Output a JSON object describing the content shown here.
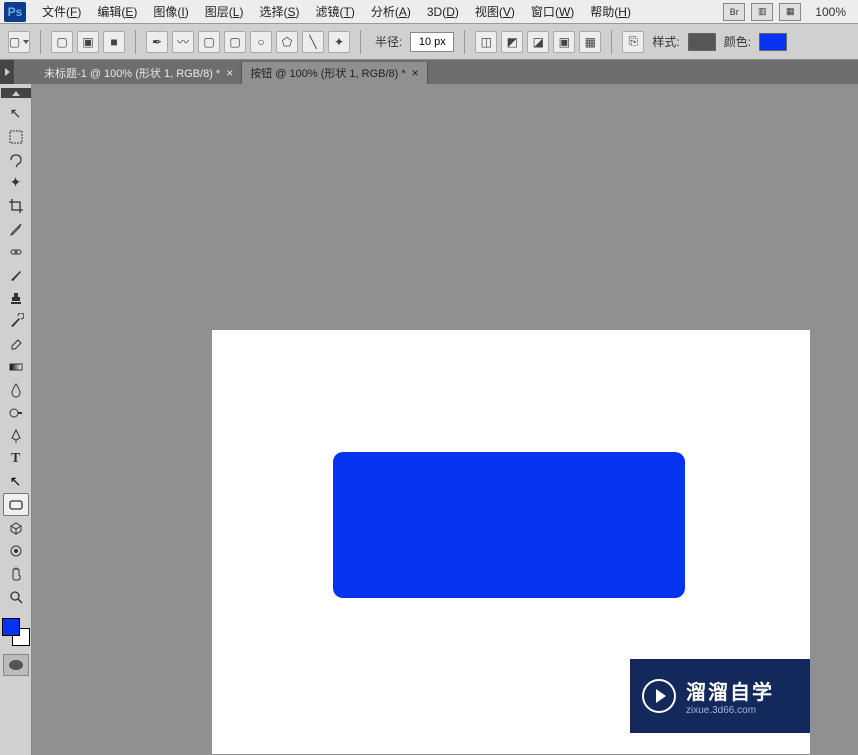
{
  "app": {
    "logo": "Ps",
    "zoom": "100%"
  },
  "menu": [
    {
      "label": "文件",
      "key": "F"
    },
    {
      "label": "编辑",
      "key": "E"
    },
    {
      "label": "图像",
      "key": "I"
    },
    {
      "label": "图层",
      "key": "L"
    },
    {
      "label": "选择",
      "key": "S"
    },
    {
      "label": "滤镜",
      "key": "T"
    },
    {
      "label": "分析",
      "key": "A"
    },
    {
      "label": "3D",
      "key": "D"
    },
    {
      "label": "视图",
      "key": "V"
    },
    {
      "label": "窗口",
      "key": "W"
    },
    {
      "label": "帮助",
      "key": "H"
    }
  ],
  "options": {
    "radius_label": "半径:",
    "radius_value": "10 px",
    "style_label": "样式:",
    "color_label": "颜色:",
    "style_color": "#565656",
    "fill_color": "#0533ef"
  },
  "tabs": [
    {
      "title": "未标题-1 @ 100% (形状 1, RGB/8) *",
      "active": false
    },
    {
      "title": "按钮 @ 100% (形状 1, RGB/8) *",
      "active": true
    }
  ],
  "tools": [
    {
      "name": "move-tool",
      "glyph": "↖"
    },
    {
      "name": "marquee-tool",
      "glyph": "⬚"
    },
    {
      "name": "lasso-tool",
      "glyph": "⊃"
    },
    {
      "name": "magic-wand-tool",
      "glyph": "✦"
    },
    {
      "name": "crop-tool",
      "glyph": "✂"
    },
    {
      "name": "eyedropper-tool",
      "glyph": "✎"
    },
    {
      "name": "healing-tool",
      "glyph": "✚"
    },
    {
      "name": "brush-tool",
      "glyph": "/"
    },
    {
      "name": "stamp-tool",
      "glyph": "♜"
    },
    {
      "name": "history-brush-tool",
      "glyph": "↺"
    },
    {
      "name": "eraser-tool",
      "glyph": "◪"
    },
    {
      "name": "gradient-tool",
      "glyph": "▦"
    },
    {
      "name": "blur-tool",
      "glyph": "💧"
    },
    {
      "name": "dodge-tool",
      "glyph": "🔍"
    },
    {
      "name": "pen-tool",
      "glyph": "✒"
    },
    {
      "name": "type-tool",
      "glyph": "T"
    },
    {
      "name": "path-selection-tool",
      "glyph": "↗"
    },
    {
      "name": "rectangle-tool",
      "glyph": "▢",
      "active": true
    },
    {
      "name": "3d-tool",
      "glyph": "⬣"
    },
    {
      "name": "3d-camera-tool",
      "glyph": "⬢"
    },
    {
      "name": "hand-tool",
      "glyph": "✋"
    },
    {
      "name": "zoom-tool",
      "glyph": "🔍"
    }
  ],
  "colors": {
    "foreground": "#0533ef",
    "background": "#ffffff"
  },
  "watermark": {
    "title": "溜溜自学",
    "subtitle": "zixue.3d66.com"
  }
}
